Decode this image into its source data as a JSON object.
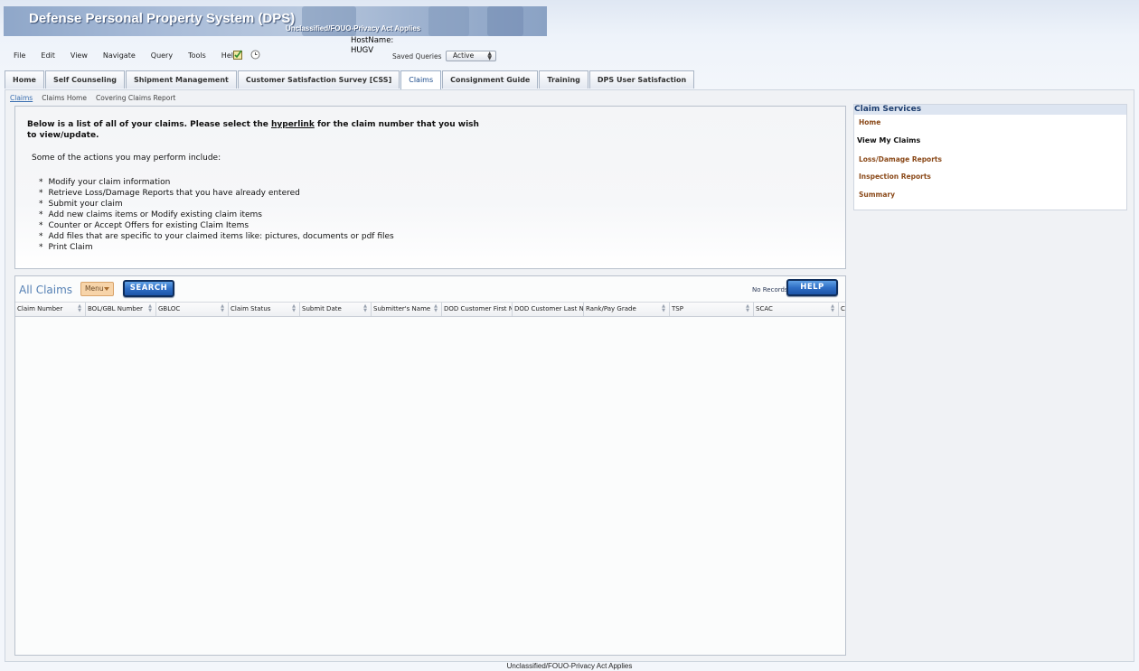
{
  "banner": {
    "title": "Defense Personal Property System (DPS)",
    "classification": "Unclassified/FOUO-Privacy Act Applies"
  },
  "menu": [
    "File",
    "Edit",
    "View",
    "Navigate",
    "Query",
    "Tools",
    "Help"
  ],
  "toolbar": {
    "icons": [
      "checklist-icon",
      "clock-icon"
    ],
    "hostname_label": "HostName:",
    "hostname_value": "HUGV",
    "saved_queries_label": "Saved Queries",
    "saved_queries_value": "Active"
  },
  "tabs": [
    {
      "label": "Home",
      "active": false
    },
    {
      "label": "Self Counseling",
      "active": false
    },
    {
      "label": "Shipment Management",
      "active": false
    },
    {
      "label": "Customer Satisfaction Survey [CSS]",
      "active": false
    },
    {
      "label": "Claims",
      "active": true
    },
    {
      "label": "Consignment Guide",
      "active": false
    },
    {
      "label": "Training",
      "active": false
    },
    {
      "label": "DPS User Satisfaction",
      "active": false
    }
  ],
  "subnav": [
    "Claims",
    "Claims Home",
    "Covering Claims Report"
  ],
  "info": {
    "intro_pre": "Below is a list of all of your claims.  Please select the ",
    "intro_link": "hyperlink",
    "intro_post": " for the claim number that you  wish to view/update.",
    "sub": "Some of the actions you may perform include:",
    "actions": [
      "Modify your claim information",
      "Retrieve Loss/Damage Reports that you have already entered",
      "Submit your claim",
      "Add new claims items or Modify existing claim items",
      "Counter or Accept Offers for existing Claim Items",
      "Add files that are specific to your claimed items like:  pictures, documents or pdf files",
      "Print Claim"
    ]
  },
  "claims_table": {
    "title": "All Claims",
    "menu_label": "Menu",
    "search_label": "SEARCH",
    "help_label": "HELP",
    "status": "No Records",
    "columns": [
      "Claim Number",
      "BOL/GBL Number",
      "GBLOC",
      "Claim Status",
      "Submit Date",
      "Submitter's Name",
      "DOD Customer First Name",
      "DOD Customer Last Name",
      "Rank/Pay Grade",
      "TSP",
      "SCAC",
      "C"
    ],
    "rows": []
  },
  "side_panel": {
    "title": "Claim Services",
    "links": [
      {
        "label": "Home",
        "current": false
      },
      {
        "label": "View My Claims",
        "current": true
      },
      {
        "label": "Loss/Damage Reports",
        "current": false
      },
      {
        "label": "Inspection Reports",
        "current": false
      },
      {
        "label": "Summary",
        "current": false
      }
    ]
  },
  "footer": "Unclassified/FOUO-Privacy Act Applies"
}
